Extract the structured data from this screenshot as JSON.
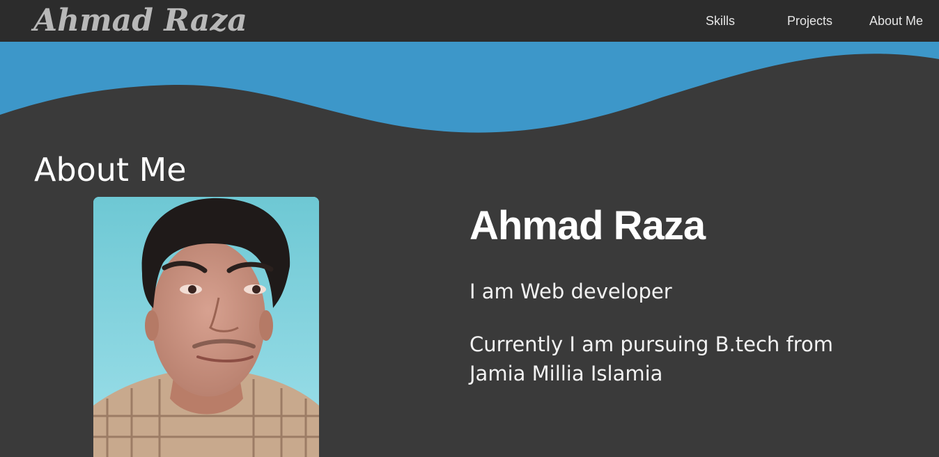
{
  "navbar": {
    "brand": "Ahmad Raza",
    "links": [
      "Skills",
      "Projects",
      "About Me"
    ]
  },
  "colors": {
    "navbar_bg": "#2c2c2c",
    "page_bg": "#3a3a3a",
    "wave_blue": "#3d97c9",
    "brand_text": "#b8b8b8",
    "text": "#ffffff"
  },
  "about": {
    "section_title": "About Me",
    "name": "Ahmad Raza",
    "role": "I am Web developer",
    "education": "Currently I am pursuing B.tech from Jamia Millia Islamia"
  },
  "photo": {
    "icon": "profile-photo"
  }
}
